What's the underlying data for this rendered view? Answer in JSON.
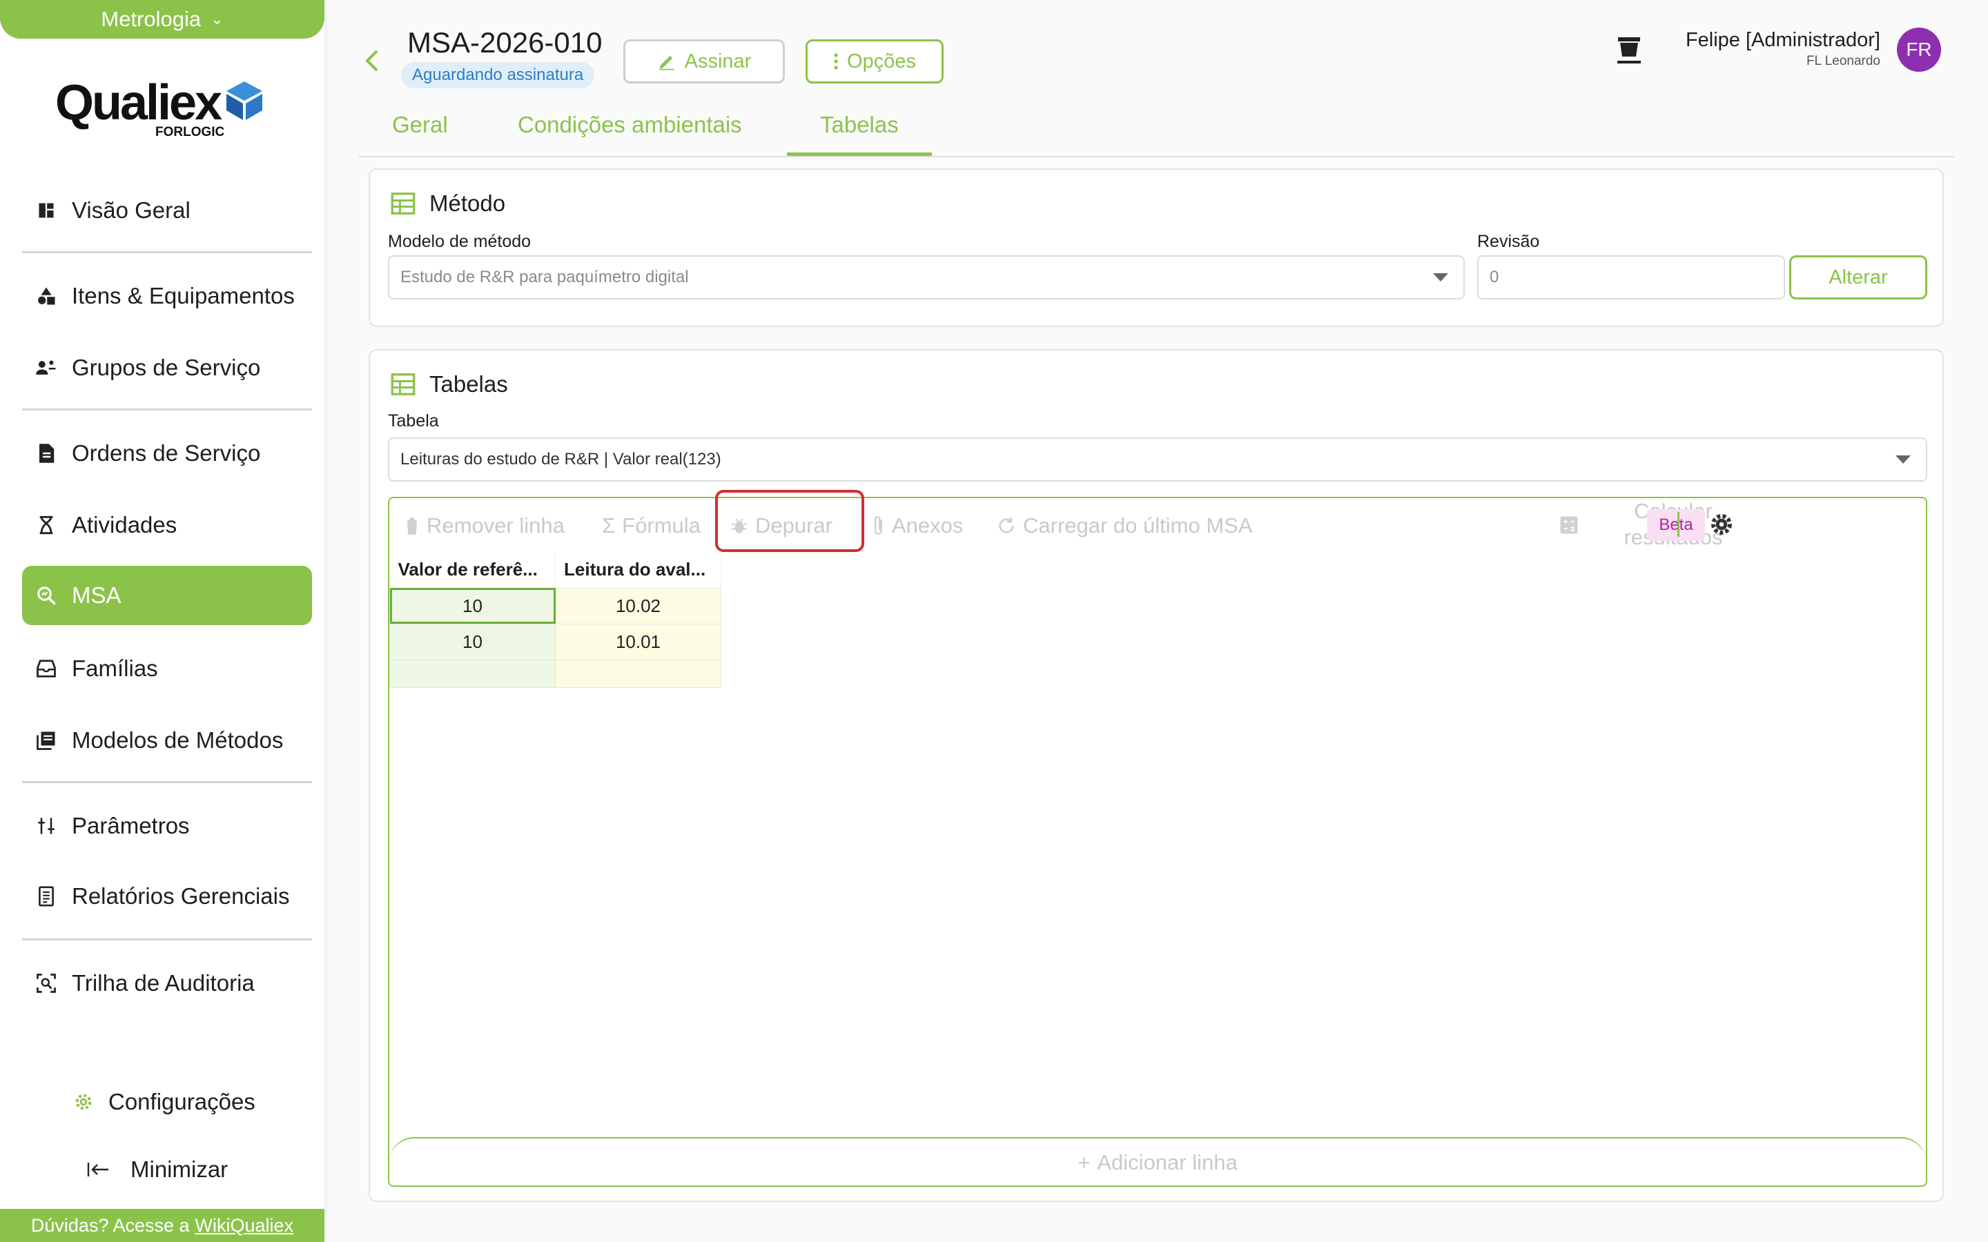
{
  "sidebar": {
    "module": "Metrologia",
    "logo": {
      "name": "Qualiex",
      "sub": "FORLOGIC"
    },
    "items": [
      {
        "label": "Visão Geral",
        "icon": "dashboard-icon"
      },
      {
        "label": "Itens & Equipamentos",
        "icon": "shapes-icon"
      },
      {
        "label": "Grupos de Serviço",
        "icon": "group-icon"
      },
      {
        "label": "Ordens de Serviço",
        "icon": "document-icon"
      },
      {
        "label": "Atividades",
        "icon": "hourglass-icon"
      },
      {
        "label": "MSA",
        "icon": "magnify-icon"
      },
      {
        "label": "Famílias",
        "icon": "drawer-icon"
      },
      {
        "label": "Modelos de Métodos",
        "icon": "library-icon"
      },
      {
        "label": "Parâmetros",
        "icon": "sliders-icon"
      },
      {
        "label": "Relatórios Gerenciais",
        "icon": "report-icon"
      },
      {
        "label": "Trilha de Auditoria",
        "icon": "audit-icon"
      }
    ],
    "settings": "Configurações",
    "minimize": "Minimizar",
    "help_prefix": "Dúvidas? Acesse a",
    "help_link": "WikiQualiex"
  },
  "header": {
    "title": "MSA-2026-010",
    "status": "Aguardando assinatura",
    "sign_button": "Assinar",
    "options_button": "Opções",
    "user_name": "Felipe [Administrador]",
    "user_org": "FL Leonardo",
    "avatar": "FR"
  },
  "tabs": [
    "Geral",
    "Condições ambientais",
    "Tabelas"
  ],
  "metodo": {
    "title": "Método",
    "model_label": "Modelo de método",
    "model_value": "Estudo de R&R para paquímetro digital",
    "revision_label": "Revisão",
    "revision_value": "0",
    "change_button": "Alterar"
  },
  "tabelas": {
    "title": "Tabelas",
    "table_label": "Tabela",
    "table_value": "Leituras do estudo de R&R | Valor real(123)",
    "toolbar": {
      "remove_row": "Remover linha",
      "formula": "Fórmula",
      "debug": "Depurar",
      "attachments": "Anexos",
      "load_last": "Carregar do último MSA",
      "calc_line1": "Calcular",
      "calc_line2": "resultados",
      "beta": "Beta"
    },
    "columns": [
      "Valor de referê...",
      "Leitura do aval..."
    ],
    "rows": [
      [
        "10",
        "10.02"
      ],
      [
        "10",
        "10.01"
      ]
    ],
    "add_row": "Adicionar linha"
  },
  "colors": {
    "accent": "#8bc34a",
    "highlight": "#d32f2f",
    "avatar": "#8e2fb0"
  }
}
